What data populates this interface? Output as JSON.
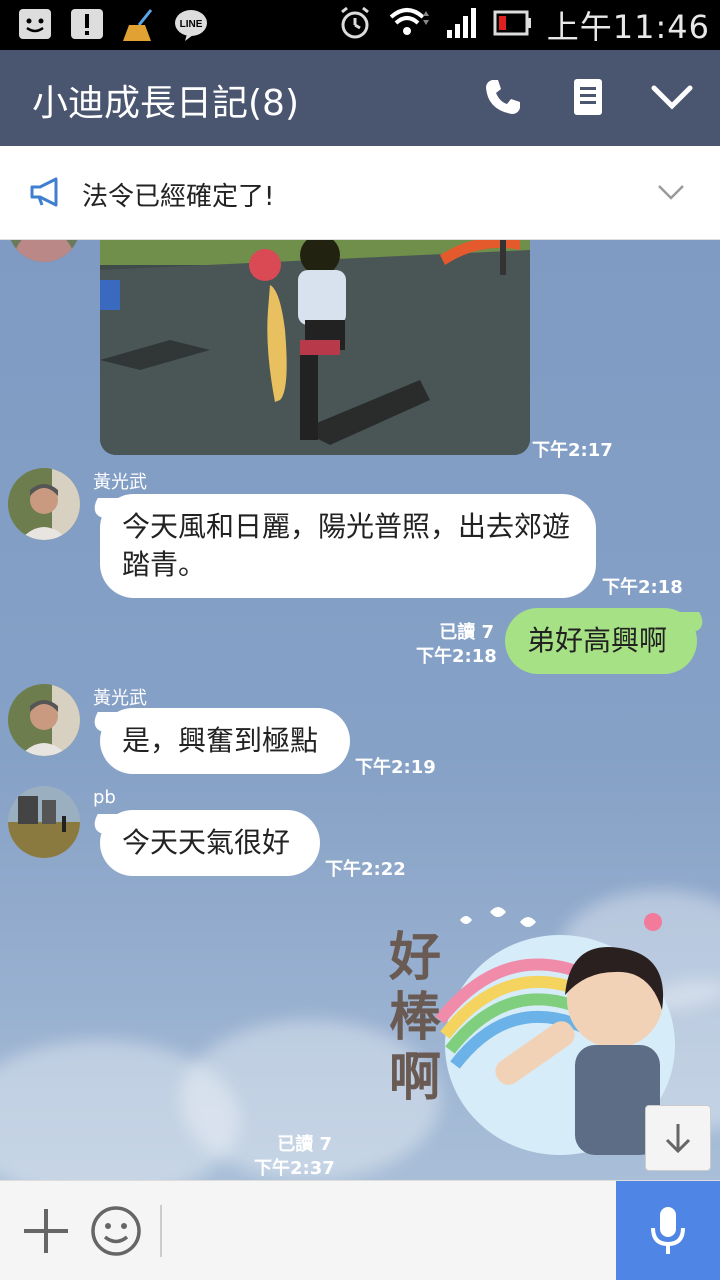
{
  "status_bar": {
    "time": "上午11:46",
    "icons": [
      "face-notification-icon",
      "alert-notification-icon",
      "broom-icon",
      "line-app-icon",
      "alarm-icon",
      "wifi-icon",
      "signal-icon",
      "battery-low-icon"
    ]
  },
  "header": {
    "title": "小迪成長日記(8)",
    "icons": [
      "phone-icon",
      "note-icon",
      "chevron-down-icon"
    ],
    "background": "#4a5570"
  },
  "announcement": {
    "text": "法令已經確定了!",
    "icon": "megaphone-icon"
  },
  "messages": [
    {
      "type": "image",
      "sender_side": "left",
      "time": "下午2:17"
    },
    {
      "type": "text",
      "sender": "黃光武",
      "text": "今天風和日麗，陽光普照，出去郊遊踏青。",
      "time": "下午2:18"
    },
    {
      "type": "text",
      "sender_side": "right",
      "text": "弟好高興啊",
      "read": "已讀 7",
      "time": "下午2:18"
    },
    {
      "type": "text",
      "sender": "黃光武",
      "text": "是，興奮到極點",
      "time": "下午2:19"
    },
    {
      "type": "text",
      "sender": "pb",
      "text": "今天天氣很好",
      "time": "下午2:22"
    },
    {
      "type": "sticker",
      "sender_side": "right",
      "sticker_text": "好棒啊",
      "read": "已讀 7",
      "time": "下午2:37"
    }
  ],
  "input_bar": {
    "icons": [
      "plus-icon",
      "emoji-icon",
      "microphone-icon"
    ],
    "accent": "#4f86e6"
  },
  "colors": {
    "my_bubble": "#a6e186",
    "other_bubble": "#ffffff",
    "chat_bg": "#7f9cc2"
  }
}
